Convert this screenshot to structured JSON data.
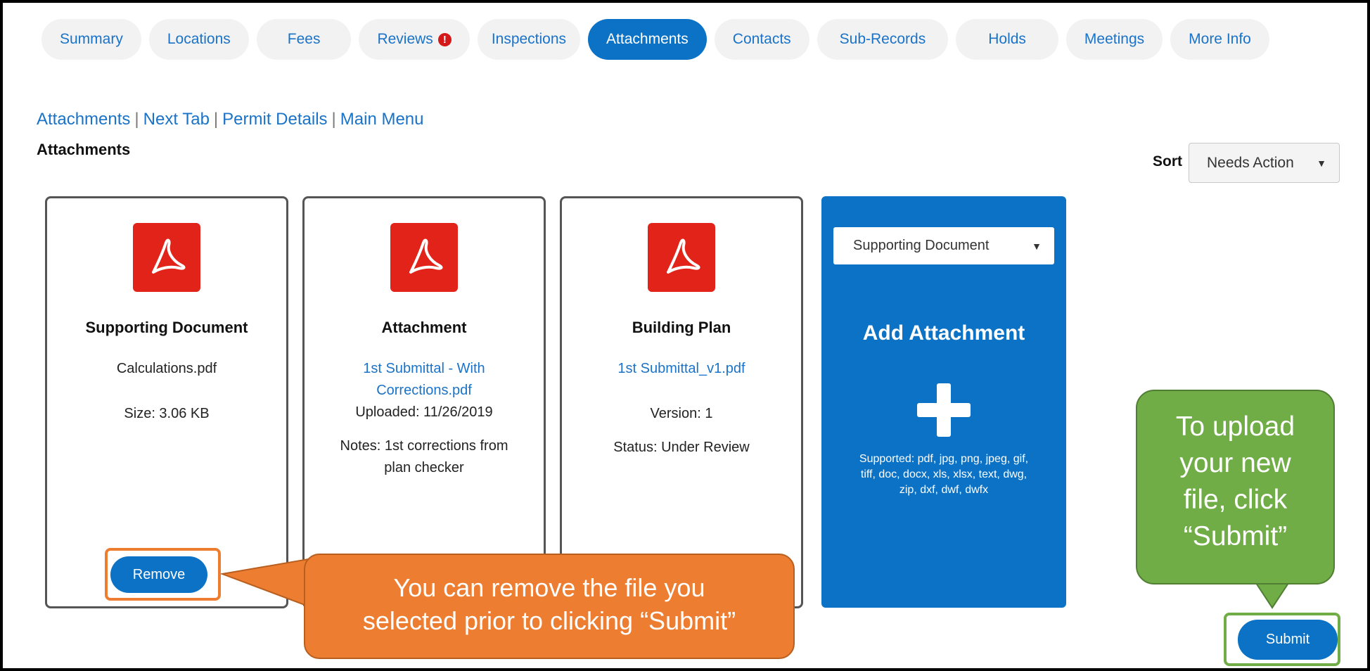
{
  "tabs": [
    {
      "label": "Summary"
    },
    {
      "label": "Locations"
    },
    {
      "label": "Fees"
    },
    {
      "label": "Reviews",
      "alert": "!"
    },
    {
      "label": "Inspections"
    },
    {
      "label": "Attachments",
      "active": true
    },
    {
      "label": "Contacts"
    },
    {
      "label": "Sub-Records"
    },
    {
      "label": "Holds"
    },
    {
      "label": "Meetings"
    },
    {
      "label": "More Info"
    }
  ],
  "breadcrumb": {
    "attachments": "Attachments",
    "next_tab": "Next Tab",
    "permit_details": "Permit Details",
    "main_menu": "Main Menu",
    "separator": "|"
  },
  "section_title": "Attachments",
  "sort": {
    "label": "Sort",
    "value": "Needs Action"
  },
  "cards": [
    {
      "icon": "pdf-icon",
      "title": "Supporting Document",
      "file": "Calculations.pdf",
      "size": "Size: 3.06 KB",
      "remove_label": "Remove"
    },
    {
      "icon": "pdf-icon",
      "title": "Attachment",
      "file_line1": "1st Submittal - With",
      "file_line2": "Corrections.pdf",
      "uploaded": "Uploaded: 11/26/2019",
      "notes_line1": "Notes: 1st corrections from",
      "notes_line2": "plan checker"
    },
    {
      "icon": "pdf-icon",
      "title": "Building Plan",
      "file": "1st Submittal_v1.pdf",
      "version": "Version: 1",
      "status": "Status: Under Review"
    }
  ],
  "add_attachment": {
    "type_value": "Supporting Document",
    "title": "Add Attachment",
    "supported_line1": "Supported: pdf, jpg, png, jpeg, gif,",
    "supported_line2": "tiff, doc, docx, xls, xlsx, text, dwg,",
    "supported_line3": "zip, dxf, dwf, dwfx"
  },
  "submit_label": "Submit",
  "callouts": {
    "remove_line1": "You can remove the file you",
    "remove_line2": "selected prior to clicking “Submit”",
    "submit_line1": "To upload",
    "submit_line2": "your new",
    "submit_line3": "file, click",
    "submit_line4": "“Submit”"
  },
  "colors": {
    "primary": "#0b72c6",
    "link": "#1a73c8",
    "pdf_red": "#e2231a",
    "callout_orange": "#ed7d31",
    "callout_green": "#70ad47",
    "alert_red": "#d21818"
  }
}
